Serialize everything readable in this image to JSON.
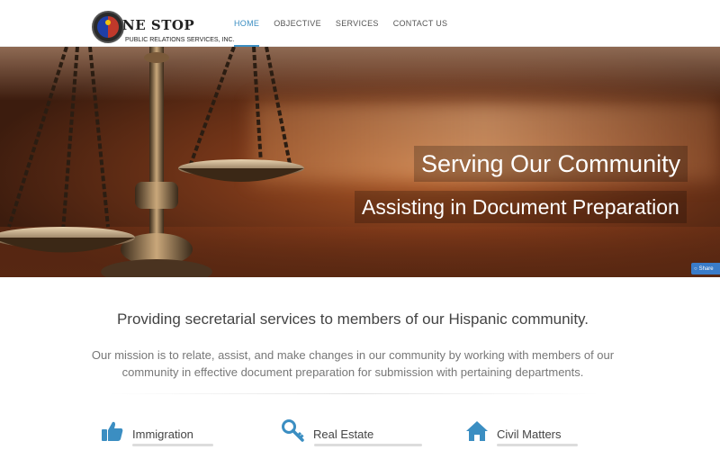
{
  "brand": {
    "logo_title": "NE STOP",
    "logo_subtitle": "PUBLIC RELATIONS SERVICES, INC."
  },
  "nav": {
    "items": [
      {
        "label": "HOME",
        "active": true
      },
      {
        "label": "OBJECTIVE",
        "active": false
      },
      {
        "label": "SERVICES",
        "active": false
      },
      {
        "label": "CONTACT US",
        "active": false
      }
    ]
  },
  "hero": {
    "headline": "Serving Our Community",
    "subheadline": "Assisting in Document Preparation",
    "share_label": "Share"
  },
  "intro": {
    "tagline": "Providing secretarial services to members of our Hispanic community.",
    "mission": "Our mission is to relate, assist, and make changes in our community by working with members of our community in effective document preparation for submission with pertaining departments."
  },
  "features": [
    {
      "title": "Immigration",
      "icon": "thumbs-up-icon"
    },
    {
      "title": "Real Estate",
      "icon": "key-icon"
    },
    {
      "title": "Civil Matters",
      "icon": "home-icon"
    }
  ],
  "colors": {
    "accent": "#3b8ec2",
    "feature_icon": "#3b8ec2",
    "share_button": "#3a7cc9"
  }
}
